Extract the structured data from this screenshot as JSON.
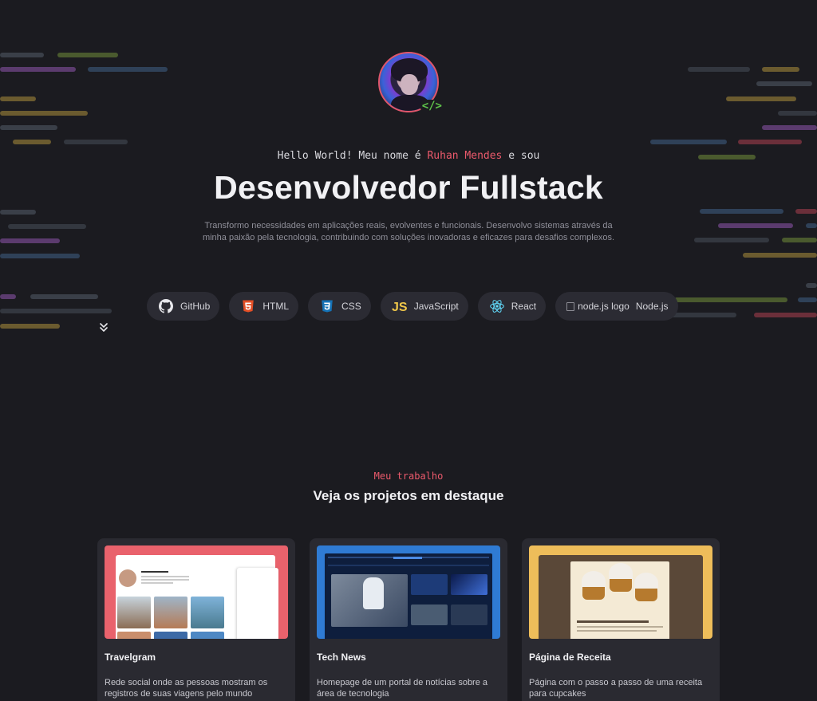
{
  "hero": {
    "greeting_prefix": "Hello World! Meu nome é",
    "name": "Ruhan Mendes",
    "greeting_suffix": "e sou",
    "title": "Desenvolvedor Fullstack",
    "description": "Transformo necessidades em aplicações reais, evolventes e funcionais. Desenvolvo sistemas através da minha paixão pela tecnologia, contribuindo com soluções inovadoras e eficazes para desafios complexos.",
    "avatar_badge": "</>"
  },
  "tech": [
    {
      "label": "GitHub",
      "icon": "github-icon"
    },
    {
      "label": "HTML",
      "icon": "html5-icon"
    },
    {
      "label": "CSS",
      "icon": "css3-icon"
    },
    {
      "label": "JavaScript",
      "icon": "javascript-icon"
    },
    {
      "label": "React",
      "icon": "react-icon"
    },
    {
      "label": "Node.js",
      "icon": "nodejs-icon",
      "broken_alt": "node.js logo"
    }
  ],
  "projects_section": {
    "kicker": "Meu trabalho",
    "title": "Veja os projetos em destaque"
  },
  "projects": [
    {
      "title": "Travelgram",
      "description": "Rede social onde as pessoas mostram os registros de suas viagens pelo mundo"
    },
    {
      "title": "Tech News",
      "description": "Homepage de um portal de notícias sobre a área de tecnologia"
    },
    {
      "title": "Página de Receita",
      "description": "Página com o passo a passo de uma receita para cupcakes"
    }
  ],
  "colors": {
    "background": "#1b1b20",
    "accent": "#ec5a6c",
    "chip": "#2b2b33",
    "card": "#2a2a31"
  }
}
